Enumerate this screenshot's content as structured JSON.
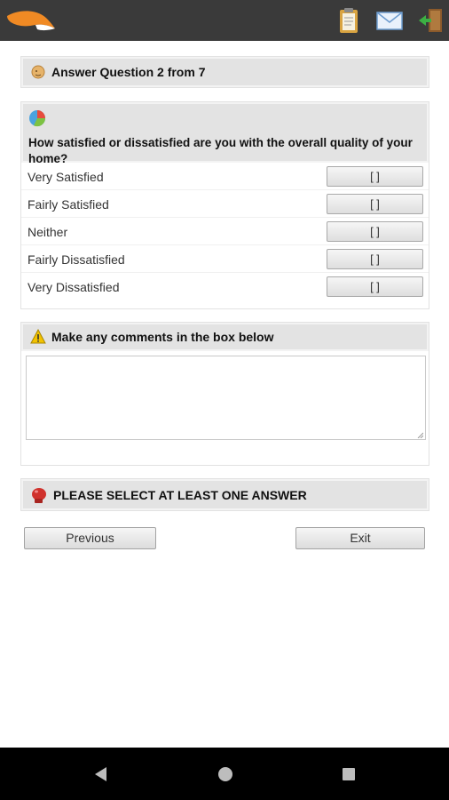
{
  "appbar": {
    "logo": "fox-tail-logo",
    "actions": [
      {
        "icon": "clipboard-icon"
      },
      {
        "icon": "envelope-icon"
      },
      {
        "icon": "exit-door-icon"
      }
    ]
  },
  "header": {
    "icon": "head-icon",
    "title": "Answer Question 2 from 7"
  },
  "question": {
    "icon": "pie-chart-icon",
    "text": "How satisfied or dissatisfied are you with the overall quality of your home?",
    "options": [
      {
        "label": "Very Satisfied",
        "button": "[ ]"
      },
      {
        "label": "Fairly Satisfied",
        "button": "[ ]"
      },
      {
        "label": "Neither",
        "button": "[ ]"
      },
      {
        "label": "Fairly Dissatisfied",
        "button": "[ ]"
      },
      {
        "label": "Very Dissatisfied",
        "button": "[ ]"
      }
    ]
  },
  "comments": {
    "icon": "warning-icon",
    "title": "Make any comments in the box below",
    "value": "",
    "placeholder": ""
  },
  "alert": {
    "icon": "boxing-glove-icon",
    "text": "PLEASE SELECT AT LEAST ONE ANSWER"
  },
  "nav": {
    "previous": "Previous",
    "exit": "Exit"
  },
  "colors": {
    "appbar": "#3a3a3a",
    "panel_head": "#e3e3e3",
    "accent": "#f08a24"
  },
  "system_nav": [
    "back-icon",
    "home-icon",
    "recents-icon"
  ]
}
